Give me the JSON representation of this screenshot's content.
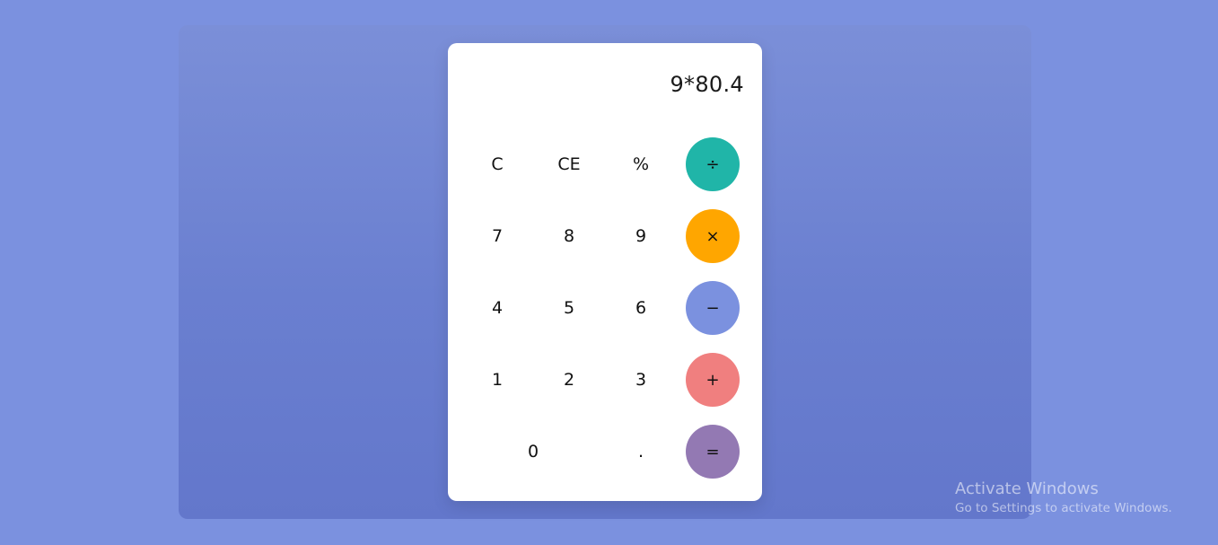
{
  "display": {
    "expression": "9*80.4"
  },
  "keys": {
    "clear": "C",
    "clear_entry": "CE",
    "percent": "%",
    "divide": "÷",
    "seven": "7",
    "eight": "8",
    "nine": "9",
    "multiply": "×",
    "four": "4",
    "five": "5",
    "six": "6",
    "subtract": "−",
    "one": "1",
    "two": "2",
    "three": "3",
    "add": "+",
    "zero": "0",
    "decimal": ".",
    "equals": "="
  },
  "colors": {
    "page_background": "#7b91df",
    "divide": "#20b5a8",
    "multiply": "#ffa600",
    "subtract": "#7b91df",
    "add": "#f07f7f",
    "equals": "#9379b3"
  },
  "watermark": {
    "title": "Activate Windows",
    "subtitle": "Go to Settings to activate Windows."
  }
}
